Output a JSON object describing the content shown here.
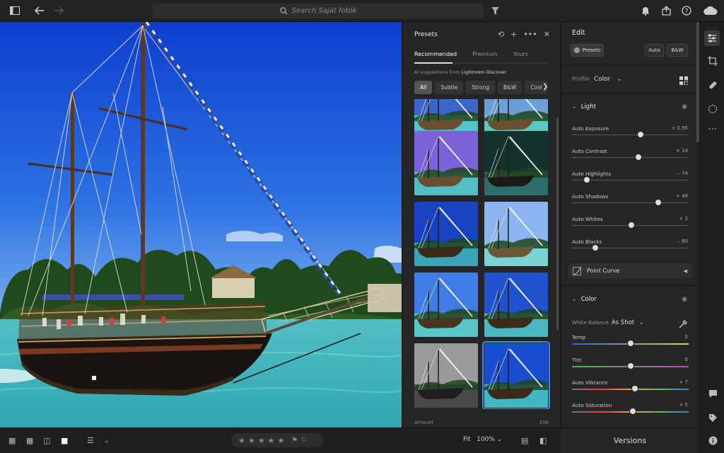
{
  "topbar": {
    "search_placeholder": "Search Saját fotók",
    "icons": [
      "sidebar-toggle-icon",
      "back-arrow-icon",
      "forward-arrow-icon",
      "search-icon",
      "filter-icon",
      "bell-icon",
      "share-icon",
      "help-icon",
      "cloud-icon"
    ]
  },
  "presets": {
    "title": "Presets",
    "tabs": [
      {
        "label": "Recommended",
        "active": true
      },
      {
        "label": "Premium",
        "active": false
      },
      {
        "label": "Yours",
        "active": false
      }
    ],
    "ai_prefix": "AI suggestions from",
    "ai_source": "Lightroom Discover",
    "chips": [
      {
        "label": "All",
        "active": true
      },
      {
        "label": "Subtle"
      },
      {
        "label": "Strong"
      },
      {
        "label": "B&W"
      },
      {
        "label": "Cool"
      }
    ],
    "amount_label": "Amount",
    "amount_value": "100",
    "thumbnails": [
      {
        "style": "teal-warm"
      },
      {
        "style": "teal-warm-2"
      },
      {
        "style": "violet"
      },
      {
        "style": "dark-teal"
      },
      {
        "style": "deep-blue"
      },
      {
        "style": "light-blue"
      },
      {
        "style": "sky"
      },
      {
        "style": "royal"
      },
      {
        "style": "bw"
      },
      {
        "style": "vivid-blue",
        "selected": true
      }
    ]
  },
  "edit": {
    "title": "Edit",
    "presets_button": "Presets",
    "auto_button": "Auto",
    "bw_button": "B&W",
    "profile_label": "Profile",
    "profile_value": "Color",
    "light_title": "Light",
    "light_sliders": [
      {
        "label": "Auto Exposure",
        "value": "+ 0,95",
        "pos": 0.59
      },
      {
        "label": "Auto Contrast",
        "value": "+ 14",
        "pos": 0.57
      },
      {
        "label": "Auto Highlights",
        "value": "– 74",
        "pos": 0.13
      },
      {
        "label": "Auto Shadows",
        "value": "+ 48",
        "pos": 0.74
      },
      {
        "label": "Auto Whites",
        "value": "+ 2",
        "pos": 0.51
      },
      {
        "label": "Auto Blacks",
        "value": "– 60",
        "pos": 0.2
      }
    ],
    "point_curve": "Point Curve",
    "color_title": "Color",
    "wb_label": "White Balance",
    "wb_value": "As Shot",
    "color_sliders": [
      {
        "label": "Temp",
        "value": "0",
        "pos": 0.5,
        "gradient": "linear-gradient(90deg,#3b5fd6,#d8d45a)"
      },
      {
        "label": "Tint",
        "value": "0",
        "pos": 0.5,
        "gradient": "linear-gradient(90deg,#47b84a,#c249c2)"
      },
      {
        "label": "Auto Vibrance",
        "value": "+ 7",
        "pos": 0.54,
        "gradient": "linear-gradient(90deg,#777,#d8453a,#d8a83a,#5ac25a,#3a7ad8)"
      },
      {
        "label": "Auto Saturation",
        "value": "+ 5",
        "pos": 0.52,
        "gradient": "linear-gradient(90deg,#777,#d8453a,#d8a83a,#5ac25a,#3a7ad8)"
      }
    ]
  },
  "versions_label": "Versions",
  "bottombar": {
    "zoom_label": "Fit",
    "zoom_value": "100%",
    "rating_stars": 5
  },
  "colors": {
    "accent": "#3a8df0"
  }
}
